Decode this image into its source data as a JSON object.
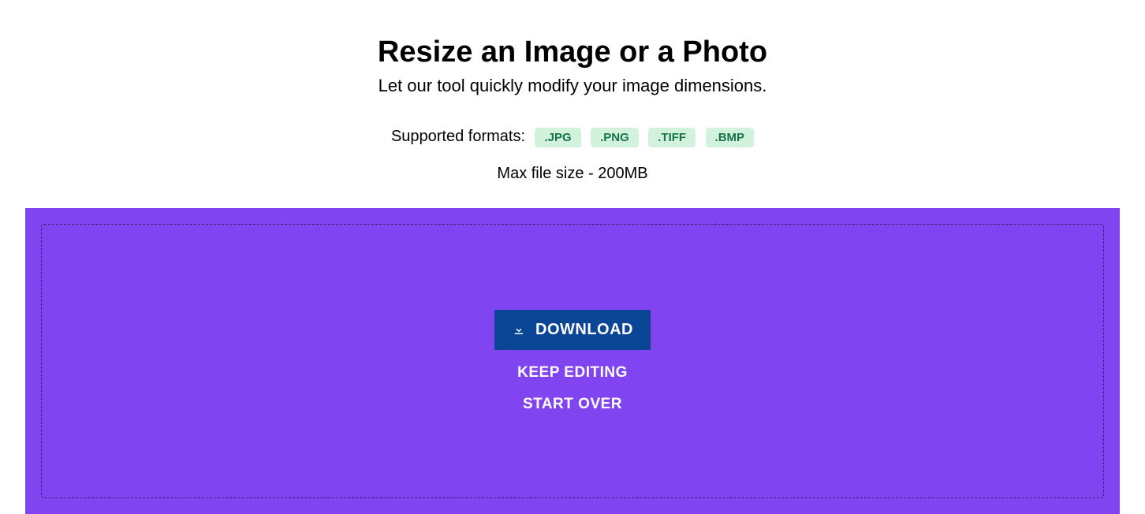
{
  "header": {
    "title": "Resize an Image or a Photo",
    "subtitle": "Let our tool quickly modify your image dimensions."
  },
  "formats": {
    "label": "Supported formats:",
    "items": [
      ".JPG",
      ".PNG",
      ".TIFF",
      ".BMP"
    ]
  },
  "max_size_text": "Max file size - 200MB",
  "actions": {
    "download": "DOWNLOAD",
    "keep_editing": "KEEP EDITING",
    "start_over": "START OVER"
  }
}
